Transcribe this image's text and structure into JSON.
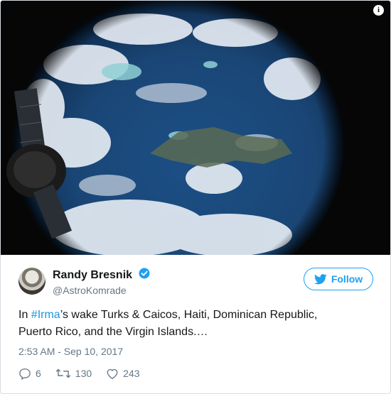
{
  "media": {
    "alt_icon": "i"
  },
  "author": {
    "name": "Randy Bresnik",
    "handle": "@AstroKomrade"
  },
  "follow_button": {
    "label": "Follow"
  },
  "tweet": {
    "prefix": "In ",
    "hashtag": "#Irma",
    "line1_rest": "’s wake Turks & Caicos, Haiti, Dominican Republic,",
    "line2": "Puerto Rico, and the Virgin Islands.…"
  },
  "timestamp": "2:53 AM - Sep 10, 2017",
  "actions": {
    "replies": "6",
    "retweets": "130",
    "likes": "243"
  },
  "colors": {
    "accent": "#1da1f2",
    "text": "#14171a",
    "muted": "#657786"
  },
  "icons": [
    "info-icon",
    "verified-badge-icon",
    "twitter-bird-icon",
    "reply-icon",
    "retweet-icon",
    "like-icon"
  ]
}
